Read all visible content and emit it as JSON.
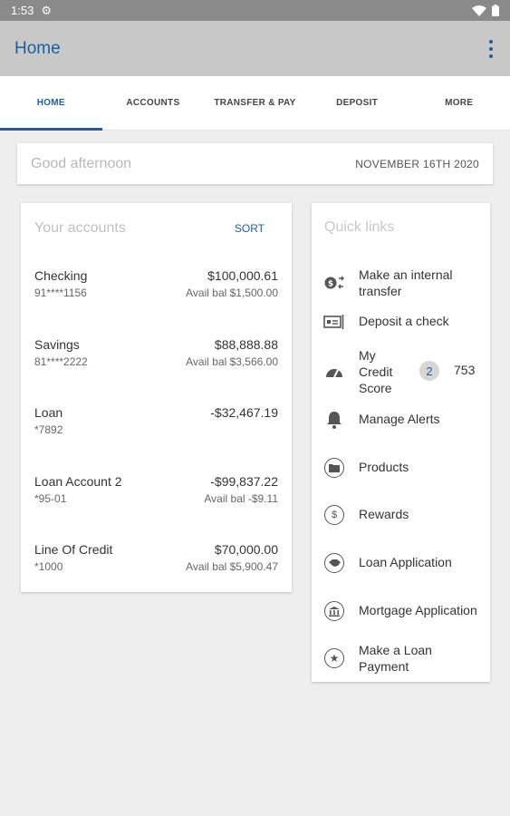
{
  "status_bar": {
    "time": "1:53"
  },
  "app_bar": {
    "title": "Home"
  },
  "tabs": [
    {
      "label": "HOME",
      "active": true
    },
    {
      "label": "ACCOUNTS"
    },
    {
      "label": "TRANSFER & PAY"
    },
    {
      "label": "DEPOSIT"
    },
    {
      "label": "MORE"
    }
  ],
  "greeting": {
    "text": "Good afternoon",
    "date": "NOVEMBER 16TH 2020"
  },
  "accounts": {
    "title": "Your accounts",
    "sort_label": "SORT",
    "items": [
      {
        "name": "Checking",
        "number": "91****1156",
        "amount": "$100,000.61",
        "avail": "Avail bal $1,500.00"
      },
      {
        "name": "Savings",
        "number": "81****2222",
        "amount": "$88,888.88",
        "avail": "Avail bal $3,566.00"
      },
      {
        "name": "Loan",
        "number": "*7892",
        "amount": "-$32,467.19",
        "avail": ""
      },
      {
        "name": "Loan Account 2",
        "number": "*95-01",
        "amount": "-$99,837.22",
        "avail": "Avail bal -$9.11"
      },
      {
        "name": "Line Of Credit",
        "number": "*1000",
        "amount": "$70,000.00",
        "avail": "Avail bal $5,900.47"
      }
    ]
  },
  "quick_links": {
    "title": "Quick links",
    "items": [
      {
        "label_lines": [
          "Make an internal",
          "transfer"
        ],
        "icon": "transfer-icon"
      },
      {
        "label_lines": [
          "Deposit a check"
        ],
        "icon": "check-deposit-icon"
      },
      {
        "label_lines": [
          "My",
          "Credit",
          "Score"
        ],
        "icon": "gauge-icon",
        "badge": "2",
        "score": "753"
      },
      {
        "label_lines": [
          "Manage Alerts"
        ],
        "icon": "bell-icon"
      },
      {
        "label_lines": [
          "Products"
        ],
        "icon": "folder-icon"
      },
      {
        "label_lines": [
          "Rewards"
        ],
        "icon": "dollar-icon"
      },
      {
        "label_lines": [
          "Loan Application"
        ],
        "icon": "handshake-icon"
      },
      {
        "label_lines": [
          "Mortgage Application"
        ],
        "icon": "bank-icon"
      },
      {
        "label_lines": [
          "Make a Loan",
          "Payment"
        ],
        "icon": "star-icon"
      }
    ]
  },
  "colors": {
    "primary": "#1d5f9c",
    "app_bar": "#c8c8c8",
    "status_bar": "#8a8a8a",
    "background": "#eeeeee"
  }
}
